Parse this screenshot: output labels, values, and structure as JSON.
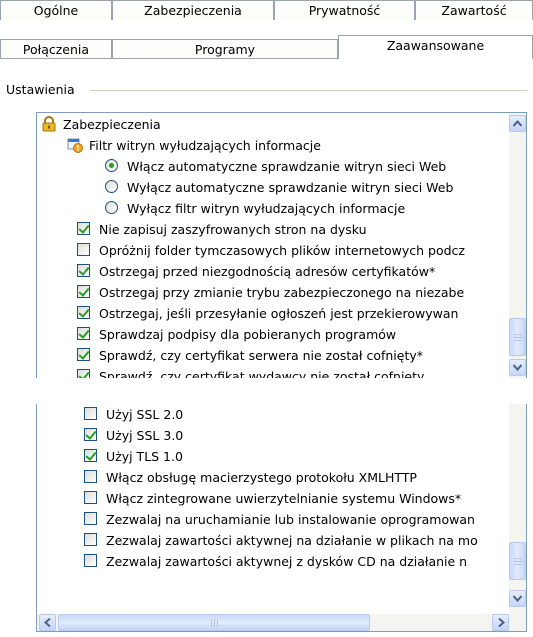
{
  "tabs": {
    "row1": [
      "Ogólne",
      "Zabezpieczenia",
      "Prywatność",
      "Zawartość"
    ],
    "row2": [
      "Połączenia",
      "Programy",
      "Zaawansowane"
    ]
  },
  "settings_label": "Ustawienia",
  "list_top": {
    "items": [
      {
        "type": "group",
        "icon": "lock-icon",
        "label": "Zabezpieczenia"
      },
      {
        "type": "group",
        "icon": "phishing-filter-icon",
        "label": "Filtr witryn wyłudzających informacje"
      },
      {
        "type": "radio",
        "checked": true,
        "label": "Włącz automatyczne sprawdzanie witryn sieci Web"
      },
      {
        "type": "radio",
        "checked": false,
        "label": "Wyłącz automatyczne sprawdzanie witryn sieci Web"
      },
      {
        "type": "radio",
        "checked": false,
        "label": "Wyłącz filtr witryn wyłudzających informacje"
      },
      {
        "type": "checkbox",
        "checked": true,
        "label": "Nie zapisuj zaszyfrowanych stron na dysku"
      },
      {
        "type": "checkbox",
        "checked": false,
        "label": "Opróżnij folder tymczasowych plików internetowych podcz"
      },
      {
        "type": "checkbox",
        "checked": true,
        "label": "Ostrzegaj przed niezgodnością adresów certyfikatów*"
      },
      {
        "type": "checkbox",
        "checked": true,
        "label": "Ostrzegaj przy zmianie trybu zabezpieczonego na niezabe"
      },
      {
        "type": "checkbox",
        "checked": true,
        "label": "Ostrzegaj, jeśli przesyłanie ogłoszeń jest przekierowywan"
      },
      {
        "type": "checkbox",
        "checked": true,
        "label": "Sprawdzaj podpisy dla pobieranych programów"
      },
      {
        "type": "checkbox",
        "checked": true,
        "label": "Sprawdź, czy certyfikat serwera nie został cofnięty*"
      },
      {
        "type": "checkbox",
        "checked": true,
        "label": "Sprawdź, czy certyfikat wydawcy nie został cofnięty"
      }
    ],
    "scroll_position": 0.85
  },
  "list_bottom": {
    "items": [
      {
        "type": "checkbox",
        "checked": false,
        "label": "Użyj SSL 2.0"
      },
      {
        "type": "checkbox",
        "checked": true,
        "label": "Użyj SSL 3.0"
      },
      {
        "type": "checkbox",
        "checked": true,
        "label": "Użyj TLS 1.0"
      },
      {
        "type": "checkbox",
        "checked": false,
        "label": "Włącz obsługę macierzystego protokołu XMLHTTP"
      },
      {
        "type": "checkbox",
        "checked": false,
        "label": "Włącz zintegrowane uwierzytelnianie systemu Windows*"
      },
      {
        "type": "checkbox",
        "checked": false,
        "label": "Zezwalaj na uruchamianie lub instalowanie oprogramowan"
      },
      {
        "type": "checkbox",
        "checked": false,
        "label": "Zezwalaj zawartości aktywnej na działanie w plikach na mo"
      },
      {
        "type": "checkbox",
        "checked": false,
        "label": "Zezwalaj zawartości aktywnej z dysków CD na działanie n"
      }
    ],
    "scroll_position": 0.85
  },
  "colors": {
    "check": "#21a121",
    "scroll_accent": "#c5d5f7",
    "border": "#7f9db9"
  }
}
